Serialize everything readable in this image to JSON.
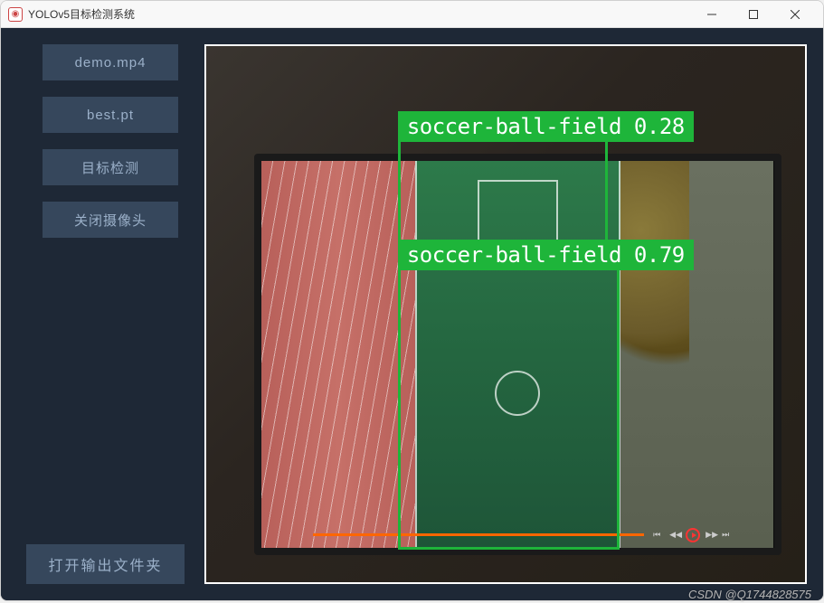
{
  "window": {
    "title": "YOLOv5目标检测系统"
  },
  "sidebar": {
    "buttons": [
      {
        "label": "demo.mp4"
      },
      {
        "label": "best.pt"
      },
      {
        "label": "目标检测"
      },
      {
        "label": "关闭摄像头"
      }
    ],
    "bottom_button": "打开输出文件夹"
  },
  "detections": [
    {
      "class_name": "soccer-ball-field",
      "confidence": "0.28",
      "label": "soccer-ball-field 0.28"
    },
    {
      "class_name": "soccer-ball-field",
      "confidence": "0.79",
      "label": "soccer-ball-field  0.79"
    }
  ],
  "watermark": "CSDN @Q1744828575",
  "colors": {
    "detection_box": "#1eb53a",
    "sidebar_bg": "#1e2836",
    "button_bg": "#36475c",
    "button_text": "#9bb0c9"
  }
}
